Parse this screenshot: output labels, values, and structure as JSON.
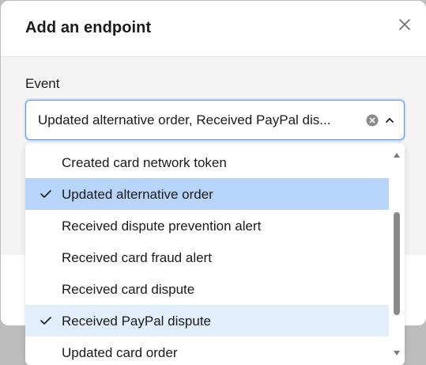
{
  "modal": {
    "title": "Add an endpoint",
    "close_icon": "close-icon"
  },
  "event": {
    "label": "Event",
    "value": "Updated alternative order, Received PayPal dis...",
    "clear_icon": "clear-circle-icon",
    "toggle_icon": "chevron-up-icon"
  },
  "dropdown": {
    "options": [
      {
        "label": "Created card network token",
        "checked": false
      },
      {
        "label": "Updated alternative order",
        "checked": true
      },
      {
        "label": "Received dispute prevention alert",
        "checked": false
      },
      {
        "label": "Received card fraud alert",
        "checked": false
      },
      {
        "label": "Received card dispute",
        "checked": false
      },
      {
        "label": "Received PayPal dispute",
        "checked": true
      },
      {
        "label": "Updated card order",
        "checked": false
      }
    ]
  },
  "colors": {
    "focus_border": "#4f8fe8",
    "active_option": "#b7d5fa",
    "selected_option": "#e2eefc"
  }
}
